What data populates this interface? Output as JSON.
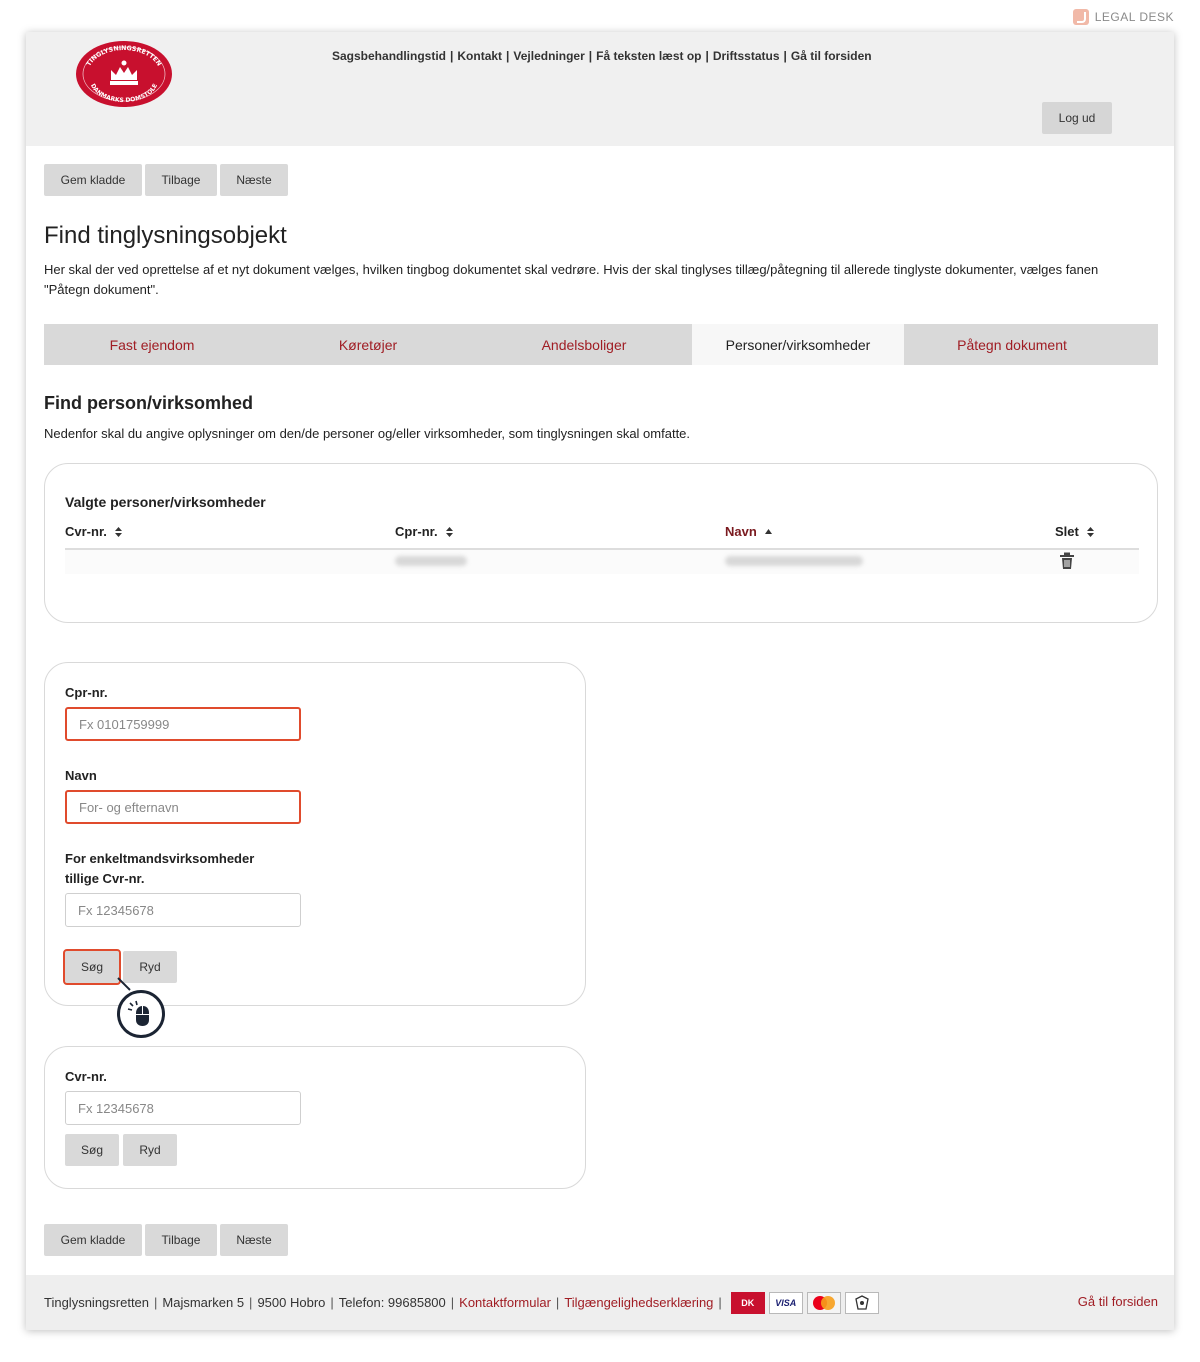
{
  "brand": {
    "name": "LEGAL DESK"
  },
  "header": {
    "links": [
      "Sagsbehandlingstid",
      "Kontakt",
      "Vejledninger",
      "Få teksten læst op",
      "Driftsstatus",
      "Gå til forsiden"
    ],
    "logout_label": "Log ud",
    "logo_text_top": "TINGLYSNINGSRETTEN",
    "logo_text_bottom": "DANMARKS DOMSTOLE"
  },
  "toolbar": {
    "save_draft": "Gem kladde",
    "back": "Tilbage",
    "next": "Næste"
  },
  "page": {
    "title": "Find tinglysningsobjekt",
    "intro": "Her skal der ved oprettelse af et nyt dokument vælges, hvilken tingbog dokumentet skal vedrøre. Hvis der skal tinglyses tillæg/påtegning til allerede tinglyste dokumenter, vælges fanen \"Påtegn dokument\"."
  },
  "tabs": [
    {
      "label": "Fast ejendom",
      "active": false
    },
    {
      "label": "Køretøjer",
      "active": false
    },
    {
      "label": "Andelsboliger",
      "active": false
    },
    {
      "label": "Personer/virksomheder",
      "active": true
    },
    {
      "label": "Påtegn dokument",
      "active": false
    }
  ],
  "section": {
    "title": "Find person/virksomhed",
    "description": "Nedenfor skal du angive oplysninger om den/de personer og/eller virksomheder, som tinglysningen skal omfatte."
  },
  "selected": {
    "title": "Valgte personer/virksomheder",
    "columns": {
      "cvr": "Cvr-nr.",
      "cpr": "Cpr-nr.",
      "name": "Navn",
      "delete": "Slet"
    },
    "sort_icon": "sort-icon",
    "sorted_icon": "sort-ascending-icon",
    "delete_icon": "trash-icon"
  },
  "cpr_search": {
    "cpr_label": "Cpr-nr.",
    "cpr_placeholder": "Fx 0101759999",
    "name_label": "Navn",
    "name_placeholder": "For- og efternavn",
    "cvr_label_line1": "For enkeltmandsvirksomheder",
    "cvr_label_line2": "tillige Cvr-nr.",
    "cvr_placeholder": "Fx 12345678",
    "search_label": "Søg",
    "clear_label": "Ryd"
  },
  "cvr_search": {
    "cvr_label": "Cvr-nr.",
    "cvr_placeholder": "Fx 12345678",
    "search_label": "Søg",
    "clear_label": "Ryd"
  },
  "footer": {
    "court": "Tinglysningsretten",
    "address": "Majsmarken 5",
    "city": "9500 Hobro",
    "phone": "Telefon: 99685800",
    "contact_link": "Kontaktformular",
    "accessibility_link": "Tilgængelighedserklæring",
    "payment_cards": [
      "DK",
      "VISA",
      "MasterCard"
    ],
    "home_link": "Gå til forsiden"
  },
  "colors": {
    "accent": "#a01d24",
    "error": "#e04b2d",
    "logo_red": "#c8102e"
  }
}
